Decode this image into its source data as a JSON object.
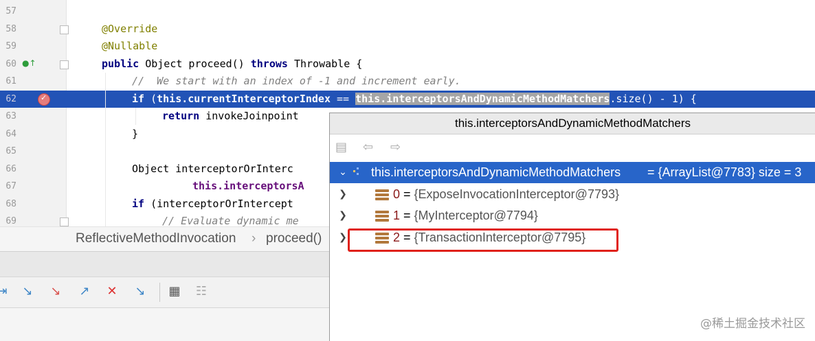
{
  "editor": {
    "lines": [
      {
        "num": "57",
        "text": ""
      },
      {
        "num": "58",
        "text": "@Override"
      },
      {
        "num": "59",
        "text": "@Nullable"
      },
      {
        "num": "60",
        "kw1": "public",
        "text": " Object proceed() ",
        "kw2": "throws",
        "text2": " Throwable {"
      },
      {
        "num": "61",
        "text": "//  We start with an index of -1 and increment early."
      },
      {
        "num": "62",
        "kw1": "if",
        "p1": " (",
        "f1": "this.currentInterceptorIndex",
        "p2": " == ",
        "sel": "this.interceptorsAndDynamicMethodMatchers",
        "p3": ".size() - 1) {"
      },
      {
        "num": "63",
        "kw1": "return",
        "text": " invokeJoinpoint"
      },
      {
        "num": "64",
        "text": "}"
      },
      {
        "num": "65",
        "text": ""
      },
      {
        "num": "66",
        "text": "Object interceptorOrInterc"
      },
      {
        "num": "67",
        "f1": "this.interceptorsA"
      },
      {
        "num": "68",
        "kw1": "if",
        "text": " (interceptorOrIntercept"
      },
      {
        "num": "69",
        "text": "// Evaluate dynamic me"
      }
    ]
  },
  "breadcrumb": {
    "class": "ReflectiveMethodInvocation",
    "sep": "›",
    "method": "proceed()"
  },
  "popup": {
    "title": "this.interceptorsAndDynamicMethodMatchers",
    "root": {
      "name": "this.interceptorsAndDynamicMethodMatchers",
      "value": " = {ArrayList@7783}  size = 3"
    },
    "items": [
      {
        "index": "0",
        "eq": " = ",
        "value": "{ExposeInvocationInterceptor@7793}"
      },
      {
        "index": "1",
        "eq": " = ",
        "value": "{MyInterceptor@7794}"
      },
      {
        "index": "2",
        "eq": " = ",
        "value": "{TransactionInterceptor@7795}"
      }
    ]
  },
  "watermark": "@稀土掘金技术社区",
  "colors": {
    "selection": "#2253b6",
    "highlight_box": "#e0211a"
  }
}
